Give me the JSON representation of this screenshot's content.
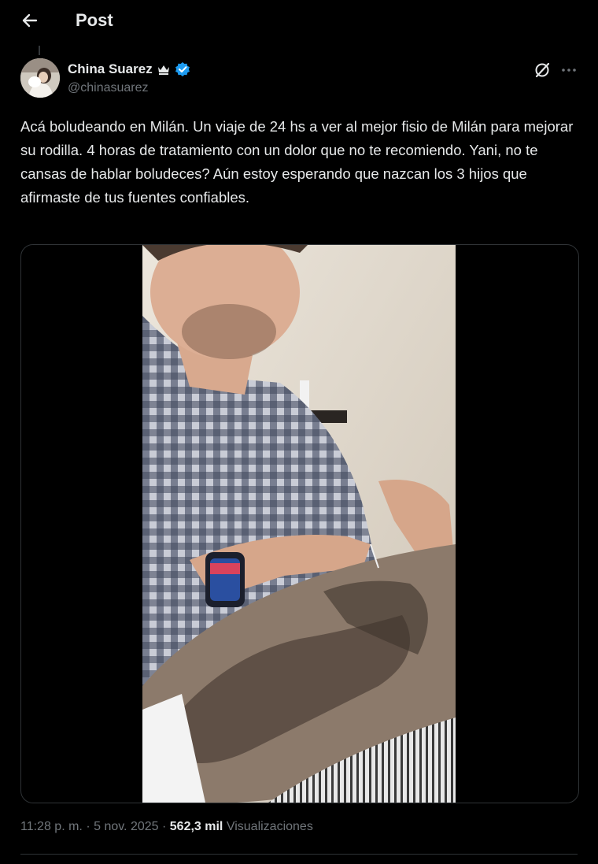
{
  "header": {
    "title": "Post",
    "back_icon": "arrow-left-icon"
  },
  "author": {
    "name": "China Suarez",
    "handle": "@chinasuarez",
    "badges": [
      "crown-icon",
      "verified-badge-icon"
    ],
    "verified_color": "#1d9bf0"
  },
  "actions": {
    "grok_icon": "grok-icon",
    "more_icon": "more-options-icon"
  },
  "tweet": {
    "text": "Acá boludeando en Milán. Un viaje de 24 hs a ver al mejor fisio de Milán para mejorar su rodilla. 4 horas de tratamiento con un dolor que no te recomiendo. Yani, no te cansas de hablar boludeces? Aún estoy esperando que nazcan los 3 hijos que afirmaste de tus fuentes confiables."
  },
  "meta": {
    "time": "11:28 p. m.",
    "date": "5 nov. 2025",
    "views_count": "562,3 mil",
    "views_label": "Visualizaciones",
    "separator": "·"
  },
  "colors": {
    "background": "#000000",
    "text": "#e7e9ea",
    "muted": "#71767b",
    "border": "#2f3336"
  }
}
